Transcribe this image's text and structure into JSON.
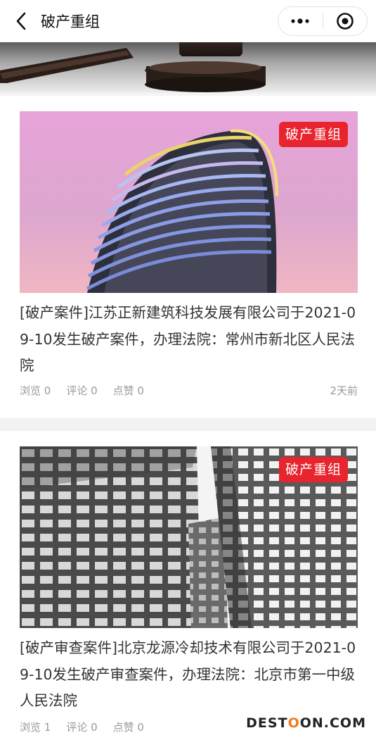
{
  "navbar": {
    "title": "破产重组"
  },
  "articles": [
    {
      "tag": "破产重组",
      "title": "[破产案件]江苏正新建筑科技发展有限公司于2021-09-10发生破产案件，办理法院：常州市新北区人民法院",
      "views": "浏览 0",
      "comments": "评论 0",
      "likes": "点赞 0",
      "time": "2天前"
    },
    {
      "tag": "破产重组",
      "title": "[破产审查案件]北京龙源冷却技术有限公司于2021-09-10发生破产审查案件，办理法院：北京市第一中级人民法院",
      "views": "浏览 1",
      "comments": "评论 0",
      "likes": "点赞 0",
      "time": ""
    }
  ],
  "watermark": {
    "prefix": "DEST",
    "o": "O",
    "suffix": "ON.COM"
  },
  "colors": {
    "tag_bg": "#e8242e",
    "meta_text": "#9a9a9a",
    "title_text": "#333333"
  }
}
